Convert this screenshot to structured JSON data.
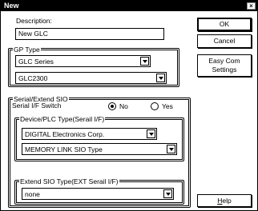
{
  "window": {
    "title": "New",
    "close_glyph": "×"
  },
  "description": {
    "label": "Description:",
    "value": "New GLC"
  },
  "gp_type": {
    "legend": "GP Type",
    "series_value": "GLC Series",
    "model_value": "GLC2300"
  },
  "serial": {
    "legend": "Serial/Extend SIO",
    "switch_label": "Serial I/F Switch",
    "radio_no": "No",
    "radio_yes": "Yes",
    "selected": "No",
    "device_legend": "Device/PLC Type(Serail I/F)",
    "maker_value": "DIGITAL Electronics Corp.",
    "link_value": "MEMORY LINK SIO Type",
    "ext_legend": "Extend SIO Type(EXT Serail I/F)",
    "ext_value": "none"
  },
  "buttons": {
    "ok": "OK",
    "cancel": "Cancel",
    "easy_com_line1": "Easy Com",
    "easy_com_line2": "Settings",
    "help": "Help"
  },
  "icons": {
    "dropdown": "chevron-down-icon",
    "close": "close-icon"
  }
}
